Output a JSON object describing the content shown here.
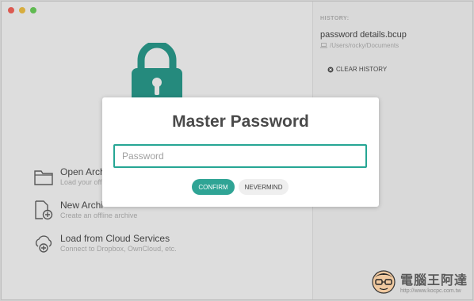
{
  "window": {
    "controls": [
      "close",
      "minimize",
      "maximize"
    ]
  },
  "main": {
    "lock_icon": "padlock-icon",
    "lock_color": "#1f8c7e",
    "actions": [
      {
        "title": "Open Archi",
        "subtitle": "Load your offl",
        "icon": "folder-icon"
      },
      {
        "title": "New Archi",
        "subtitle": "Create an offline archive",
        "icon": "new-file-icon"
      },
      {
        "title": "Load from Cloud Services",
        "subtitle": "Connect to Dropbox, OwnCloud, etc.",
        "icon": "cloud-upload-icon"
      }
    ]
  },
  "history": {
    "label": "HISTORY:",
    "items": [
      {
        "filename": "password details.bcup",
        "path": "/Users/rocky/Documents",
        "icon": "laptop-icon"
      }
    ],
    "clear_label": "CLEAR HISTORY"
  },
  "modal": {
    "title": "Master Password",
    "input_placeholder": "Password",
    "input_value": "",
    "confirm_label": "CONFIRM",
    "nevermind_label": "NEVERMIND",
    "accent_color": "#2fa495"
  },
  "watermark": {
    "title": "電腦王阿達",
    "url": "http://www.kocpc.com.tw"
  }
}
